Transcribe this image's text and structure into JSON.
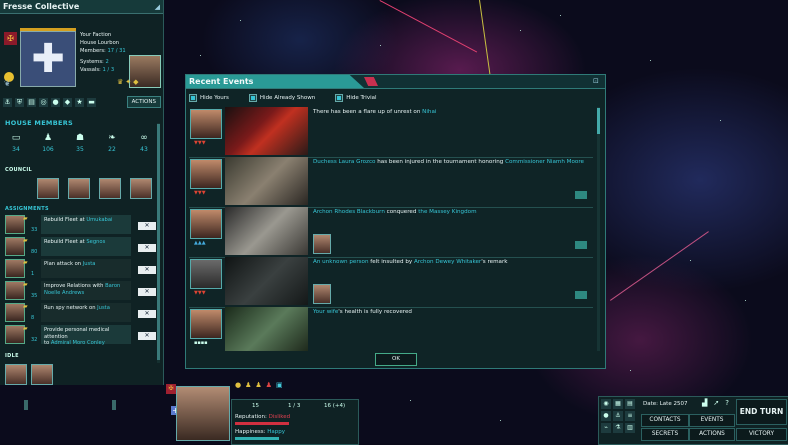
{
  "faction": {
    "title": "Fresse Collective",
    "your_faction_label": "Your Faction",
    "house_name": "House Lourbon",
    "members_label": "Members:",
    "members_value": "17 / 31",
    "systems_label": "Systems:",
    "systems_value": "2",
    "vassals_label": "Vassals:",
    "vassals_value": "1 / 3",
    "actions_label": "ACTIONS"
  },
  "house_members": {
    "heading": "HOUSE MEMBERS",
    "stats": [
      {
        "icon": "folder-icon",
        "value": "34"
      },
      {
        "icon": "crowd-icon",
        "value": "106"
      },
      {
        "icon": "people-icon",
        "value": "35"
      },
      {
        "icon": "wings-icon",
        "value": "22"
      },
      {
        "icon": "rings-icon",
        "value": "43"
      }
    ],
    "council_label": "COUNCIL",
    "assignments_label": "ASSIGNMENTS",
    "idle_label": "IDLE"
  },
  "assignments": [
    {
      "num": "33",
      "text_a": "Rebuild Fleet at ",
      "text_b": "Umukabai",
      "text_c": "",
      "text_d": "",
      "dim": false
    },
    {
      "num": "80",
      "text_a": "Rebuild Fleet at ",
      "text_b": "Segnos",
      "text_c": "",
      "text_d": "",
      "dim": false
    },
    {
      "num": "1",
      "text_a": "Plan attack on ",
      "text_b": "Justa",
      "text_c": "",
      "text_d": "",
      "dim": true
    },
    {
      "num": "35",
      "text_a": "Improve Relations with ",
      "text_b": "Baron",
      "text_c": "",
      "text_d": "Noelle Andrews",
      "dim": true
    },
    {
      "num": "8",
      "text_a": "Run spy network on ",
      "text_b": "Justa",
      "text_c": "",
      "text_d": "",
      "dim": true
    },
    {
      "num": "32",
      "text_a": "Provide personal medical attention",
      "text_b": "",
      "text_c": "to ",
      "text_d": "Admiral Moro Conley",
      "dim": false
    }
  ],
  "events": {
    "title": "Recent Events",
    "filters": [
      "Hide Yours",
      "Hide Already Shown",
      "Hide Trivial"
    ],
    "rows": [
      {
        "a": "",
        "b": "There has been a flare up of unrest on ",
        "c": "Nihai",
        "d": "",
        "e": ""
      },
      {
        "a": "Duchess Laura Grozco",
        "b": " has been injured in the tournament honoring ",
        "c": "Commissioner Niamh Moore",
        "d": "",
        "e": ""
      },
      {
        "a": "Archon Rhodes Blackburn",
        "b": " conquered ",
        "c": "the Massey Kingdom",
        "d": "",
        "e": ""
      },
      {
        "a": "An unknown person",
        "b": " felt insulted by ",
        "c": "Archon Dewey Whitaker",
        "d": "'s remark",
        "e": ""
      },
      {
        "a": "Your wife",
        "b": "'s health is fully recovered",
        "c": "",
        "d": "",
        "e": ""
      }
    ],
    "ok_label": "OK"
  },
  "character": {
    "stat1": "15",
    "stat2": "1 / 3",
    "stat3": "16 (+4)",
    "reputation_label": "Reputation: ",
    "reputation_value": "Disliked",
    "happiness_label": "Happiness: ",
    "happiness_value": "Happy"
  },
  "controls": {
    "date": "Date: Late 2507",
    "contacts": "CONTACTS",
    "events": "EVENTS",
    "secrets": "SECRETS",
    "actions": "ACTIONS",
    "victory": "VICTORY",
    "end_turn": "END TURN"
  },
  "colors": {
    "accent": "#37c6d6",
    "panel": "#0f2224",
    "danger": "#e04050"
  }
}
